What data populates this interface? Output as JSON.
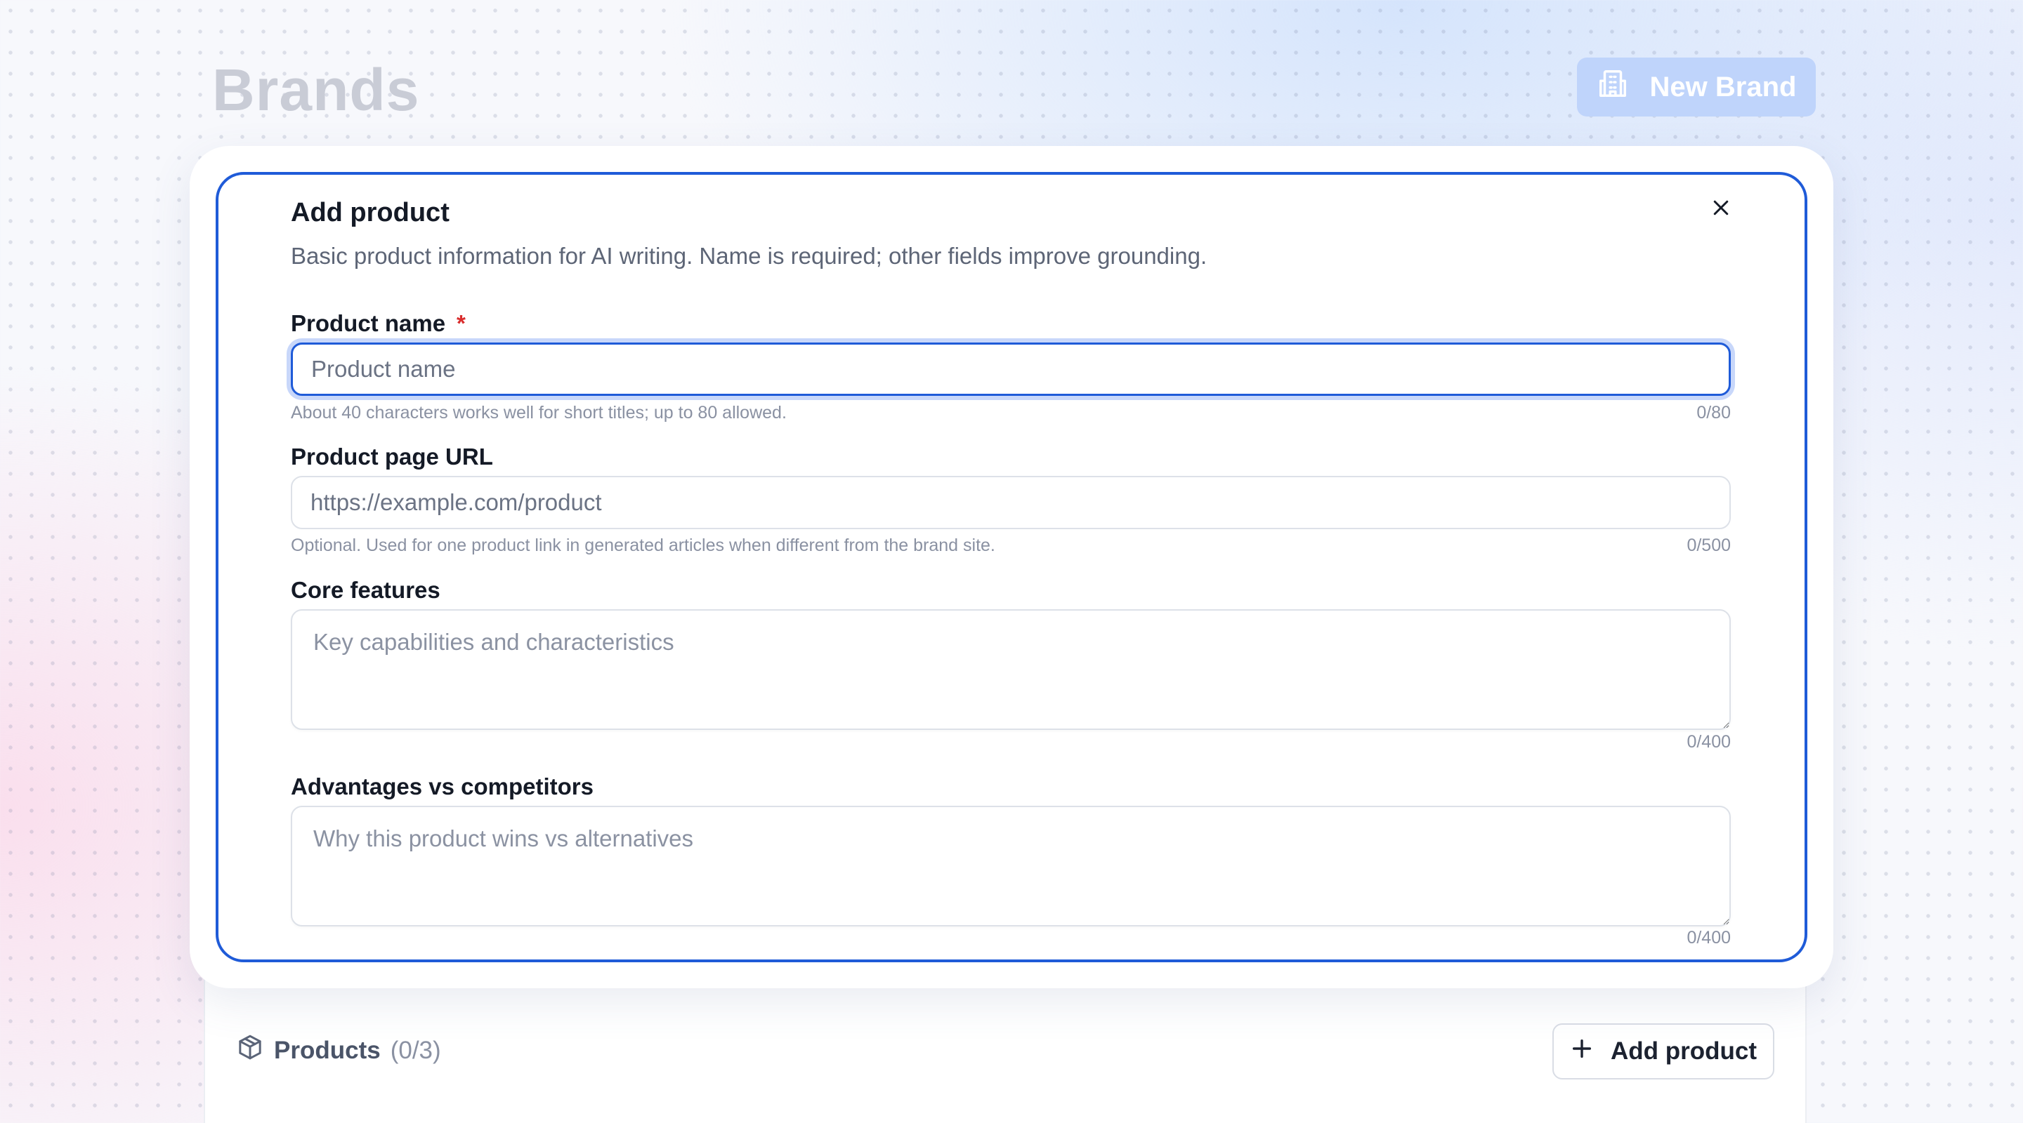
{
  "page": {
    "title": "Brands",
    "new_brand_label": "New Brand"
  },
  "modal": {
    "title": "Add product",
    "description": "Basic product information for AI writing. Name is required; other fields improve grounding.",
    "fields": {
      "name": {
        "label": "Product name",
        "required_mark": "*",
        "placeholder": "Product name",
        "value": "",
        "hint": "About 40 characters works well for short titles; up to 80 allowed.",
        "counter": "0/80"
      },
      "url": {
        "label": "Product page URL",
        "placeholder": "https://example.com/product",
        "value": "",
        "hint": "Optional. Used for one product link in generated articles when different from the brand site.",
        "counter": "0/500"
      },
      "features": {
        "label": "Core features",
        "placeholder": "Key capabilities and characteristics",
        "counter": "0/400"
      },
      "advantages": {
        "label": "Advantages vs competitors",
        "placeholder": "Why this product wins vs alternatives",
        "counter": "0/400"
      }
    }
  },
  "products": {
    "label": "Products",
    "count": "(0/3)",
    "add_label": "Add product"
  },
  "colors": {
    "accent": "#1f5bd8",
    "required": "#d92d2d",
    "new_brand_bg": "#bfd4fb"
  },
  "icons": {
    "new_brand": "building-icon",
    "close": "close-icon",
    "products": "box-icon",
    "add": "plus-icon"
  }
}
